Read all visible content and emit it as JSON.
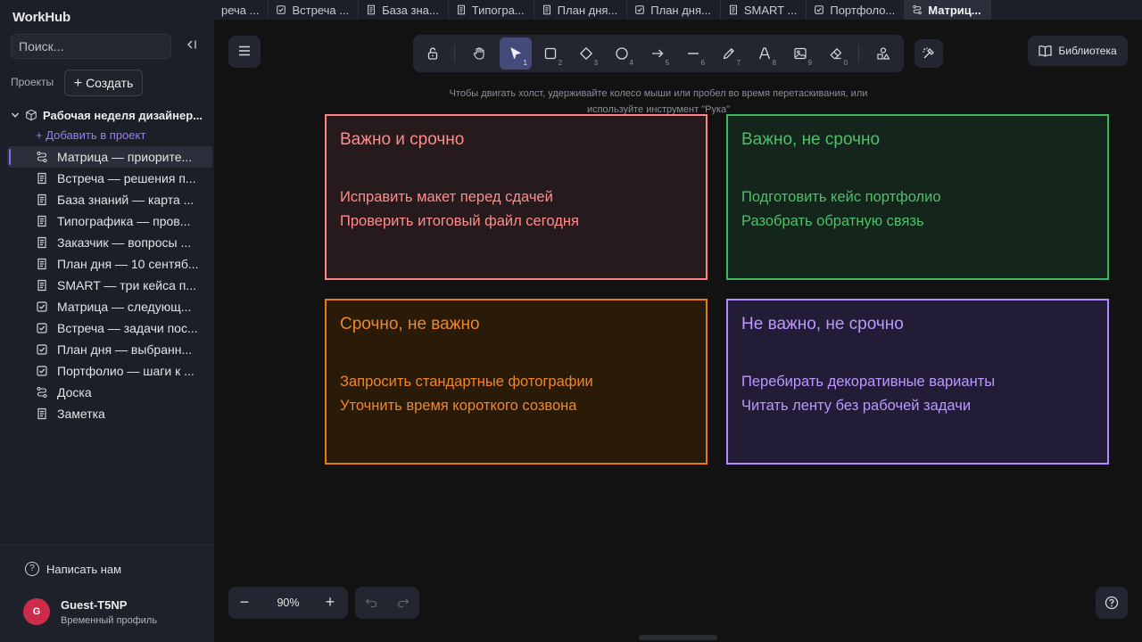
{
  "app": {
    "logo": "WorkHub"
  },
  "sidebar": {
    "search_placeholder": "Поиск...",
    "projects_label": "Проекты",
    "create_label": "Создать",
    "project_title": "Рабочая неделя дизайнер...",
    "add_to_project": "+ Добавить в проект",
    "items": [
      {
        "label": "Матрица — приорите...",
        "icon": "board-icon",
        "active": true
      },
      {
        "label": "Встреча — решения п...",
        "icon": "document-icon"
      },
      {
        "label": "База знаний — карта ...",
        "icon": "document-icon"
      },
      {
        "label": "Типографика — пров...",
        "icon": "document-icon"
      },
      {
        "label": "Заказчик — вопросы ...",
        "icon": "document-icon"
      },
      {
        "label": "План дня — 10 сентяб...",
        "icon": "document-icon"
      },
      {
        "label": "SMART — три кейса п...",
        "icon": "document-icon"
      },
      {
        "label": "Матрица — следующ...",
        "icon": "checklist-icon"
      },
      {
        "label": "Встреча — задачи пос...",
        "icon": "checklist-icon"
      },
      {
        "label": "План дня — выбранн...",
        "icon": "checklist-icon"
      },
      {
        "label": "Портфолио — шаги к ...",
        "icon": "checklist-icon"
      },
      {
        "label": "Доска",
        "icon": "board-icon"
      },
      {
        "label": "Заметка",
        "icon": "document-icon"
      }
    ],
    "help_label": "Написать нам",
    "user": {
      "initial": "G",
      "name": "Guest-T5NP",
      "subtitle": "Временный профиль"
    }
  },
  "tabs": [
    {
      "label": "реча ...",
      "icon": "none"
    },
    {
      "label": "Встреча ...",
      "icon": "checklist-icon"
    },
    {
      "label": "База зна...",
      "icon": "document-icon"
    },
    {
      "label": "Типогра...",
      "icon": "document-icon"
    },
    {
      "label": "План дня...",
      "icon": "document-icon"
    },
    {
      "label": "План дня...",
      "icon": "checklist-icon"
    },
    {
      "label": "SMART ...",
      "icon": "document-icon"
    },
    {
      "label": "Портфоло...",
      "icon": "checklist-icon"
    },
    {
      "label": "Матриц...",
      "icon": "board-icon",
      "active": true
    }
  ],
  "toolbar": {
    "tools": [
      {
        "name": "lock-tool",
        "key": ""
      },
      {
        "name": "hand-tool",
        "key": ""
      },
      {
        "name": "select-tool",
        "key": "1",
        "active": true
      },
      {
        "name": "rectangle-tool",
        "key": "2"
      },
      {
        "name": "diamond-tool",
        "key": "3"
      },
      {
        "name": "ellipse-tool",
        "key": "4"
      },
      {
        "name": "arrow-tool",
        "key": "5"
      },
      {
        "name": "line-tool",
        "key": "6"
      },
      {
        "name": "pencil-tool",
        "key": "7"
      },
      {
        "name": "text-tool",
        "key": "8"
      },
      {
        "name": "image-tool",
        "key": "9"
      },
      {
        "name": "eraser-tool",
        "key": "0"
      },
      {
        "name": "shapes-tool",
        "key": ""
      }
    ],
    "library_label": "Библиотека"
  },
  "canvas": {
    "hint": "Чтобы двигать холст, удерживайте колесо мыши или пробел во время перетаскивания, или используйте инструмент \"Рука\"",
    "quadrants": [
      {
        "title": "Важно и срочно",
        "items": [
          "Исправить макет перед сдачей",
          "Проверить итоговый файл сегодня"
        ],
        "color": "#ff8383"
      },
      {
        "title": "Важно, не срочно",
        "items": [
          "Подготовить кейс портфолио",
          "Разобрать обратную связь"
        ],
        "color": "#3fb55d"
      },
      {
        "title": "Срочно, не важно",
        "items": [
          "Запросить стандартные фотографии",
          "Уточнить время короткого созвона"
        ],
        "color": "#e8791a"
      },
      {
        "title": "Не важно, не срочно",
        "items": [
          "Перебирать декоративные варианты",
          "Читать ленту без рабочей задачи"
        ],
        "color": "#b28cff"
      }
    ]
  },
  "footer": {
    "zoom": "90%"
  }
}
